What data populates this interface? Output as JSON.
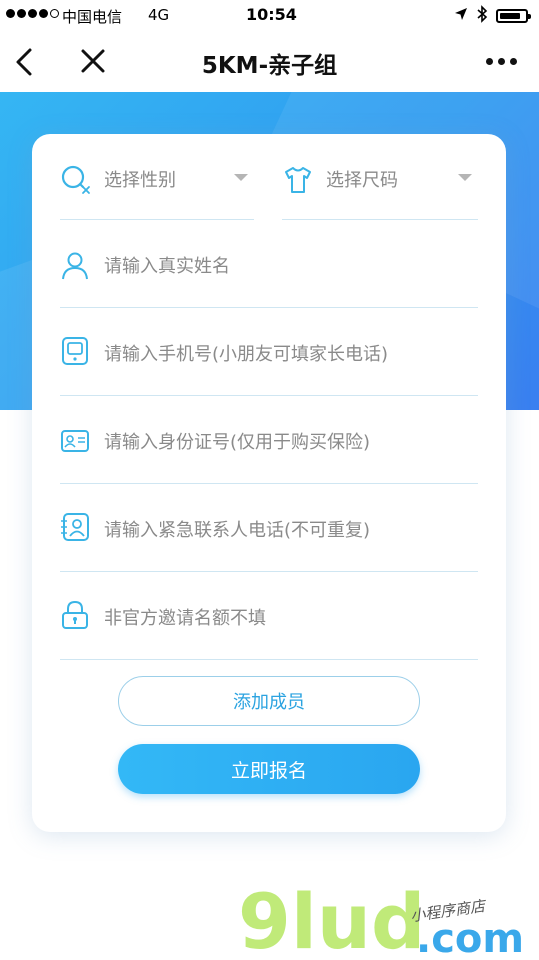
{
  "status_bar": {
    "carrier": "中国电信",
    "network": "4G",
    "time": "10:54",
    "battery_level": 0.85
  },
  "nav": {
    "title": "5KM-亲子组"
  },
  "form": {
    "gender_select": {
      "placeholder": "选择性别"
    },
    "size_select": {
      "placeholder": "选择尺码"
    },
    "name_field": {
      "placeholder": "请输入真实姓名"
    },
    "phone_field": {
      "placeholder": "请输入手机号(小朋友可填家长电话)"
    },
    "id_field": {
      "placeholder": "请输入身份证号(仅用于购买保险)"
    },
    "emergency_field": {
      "placeholder": "请输入紧急联系人电话(不可重复)"
    },
    "invite_field": {
      "placeholder": "非官方邀请名额不填"
    },
    "add_member_label": "添加成员",
    "submit_label": "立即报名"
  },
  "watermark": {
    "brand": "9lud",
    "suffix": ".com",
    "tagline": "小程序商店"
  },
  "colors": {
    "accent": "#2ba3e0",
    "banner": "#2f9bf0",
    "icon": "#3ab4e6",
    "divider": "#cfe6f2"
  }
}
